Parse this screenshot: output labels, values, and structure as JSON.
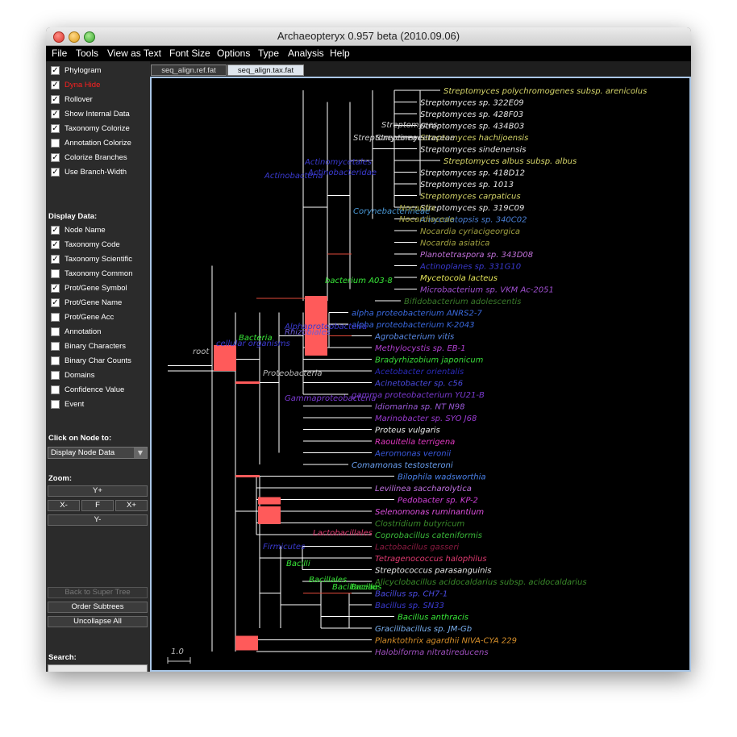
{
  "window": {
    "title": "Archaeopteryx 0.957 beta (2010.09.06)"
  },
  "menu": [
    "File",
    "Tools",
    "View as Text",
    "Font Size",
    "Options",
    "Type",
    "Analysis",
    "Help"
  ],
  "sidebar": {
    "options": [
      {
        "label": "Phylogram",
        "checked": true
      },
      {
        "label": "Dyna Hide",
        "checked": true,
        "color": "#ff2020"
      },
      {
        "label": "Rollover",
        "checked": true
      },
      {
        "label": "Show Internal Data",
        "checked": true
      },
      {
        "label": "Taxonomy Colorize",
        "checked": true
      },
      {
        "label": "Annotation Colorize",
        "checked": false
      },
      {
        "label": "Colorize Branches",
        "checked": true
      },
      {
        "label": "Use Branch-Width",
        "checked": true
      }
    ],
    "display_title": "Display Data:",
    "display": [
      {
        "label": "Node Name",
        "checked": true
      },
      {
        "label": "Taxonomy Code",
        "checked": true
      },
      {
        "label": "Taxonomy Scientific",
        "checked": true
      },
      {
        "label": "Taxonomy Common",
        "checked": false
      },
      {
        "label": "Prot/Gene Symbol",
        "checked": true
      },
      {
        "label": "Prot/Gene Name",
        "checked": true
      },
      {
        "label": "Prot/Gene Acc",
        "checked": false
      },
      {
        "label": "Annotation",
        "checked": false
      },
      {
        "label": "Binary Characters",
        "checked": false
      },
      {
        "label": "Binary Char Counts",
        "checked": false
      },
      {
        "label": "Domains",
        "checked": false
      },
      {
        "label": "Confidence Value",
        "checked": false
      },
      {
        "label": "Event",
        "checked": false
      }
    ],
    "click_title": "Click on Node to:",
    "click_value": "Display Node Data",
    "zoom_title": "Zoom:",
    "zoom": {
      "y_plus": "Y+",
      "x_minus": "X-",
      "fit": "F",
      "x_plus": "X+",
      "y_minus": "Y-"
    },
    "buttons": {
      "back": "Back to Super Tree",
      "order": "Order Subtrees",
      "uncollapse": "Uncollapse All"
    },
    "search_title": "Search:"
  },
  "tabs": [
    {
      "label": "seq_align.ref.fat",
      "active": false
    },
    {
      "label": "seq_align.tax.fat",
      "active": true
    }
  ],
  "tree": {
    "leaves": [
      {
        "label": "Streptomyces polychromogenes subsp. arenicolus",
        "color": "#d6d66a"
      },
      {
        "label": "Streptomyces sp. 322E09",
        "color": "#e8e8e8"
      },
      {
        "label": "Streptomyces sp. 428F03",
        "color": "#e8e8e8"
      },
      {
        "label": "Streptomyces sp. 434B03",
        "color": "#e8e8e8"
      },
      {
        "label": "Streptomyces hachijoensis",
        "color": "#d6d66a"
      },
      {
        "label": "Streptomyces sindenensis",
        "color": "#e8e8e8"
      },
      {
        "label": "Streptomyces albus subsp. albus",
        "color": "#d6d66a"
      },
      {
        "label": "Streptomyces sp. 418D12",
        "color": "#e8e8e8"
      },
      {
        "label": "Streptomyces sp. 1013",
        "color": "#e8e8e8"
      },
      {
        "label": "Streptomyces carpaticus",
        "color": "#d6d66a"
      },
      {
        "label": "Streptomyces sp. 319C09",
        "color": "#e8e8e8"
      },
      {
        "label": "Amycolatopsis sp. 340C02",
        "color": "#4a7fd4"
      },
      {
        "label": "Nocardia cyriacigeorgica",
        "color": "#a0a040"
      },
      {
        "label": "Nocardia asiatica",
        "color": "#a0a040"
      },
      {
        "label": "Planotetraspora sp. 343D08",
        "color": "#c070d8"
      },
      {
        "label": "Actinoplanes sp. 331G10",
        "color": "#3a3ad0"
      },
      {
        "label": "Mycetocola lacteus",
        "color": "#e8e85a"
      },
      {
        "label": "Microbacterium sp. VKM Ac-2051",
        "color": "#a050d0"
      },
      {
        "label": "Bifidobacterium adolescentis",
        "color": "#3a7a2a"
      },
      {
        "label": "alpha proteobacterium ANRS2-7",
        "color": "#3a6ae0"
      },
      {
        "label": "alpha proteobacterium K-2043",
        "color": "#3a6ae0"
      },
      {
        "label": "Agrobacterium vitis",
        "color": "#5a8ae8"
      },
      {
        "label": "Methylocystis sp. EB-1",
        "color": "#b040d0"
      },
      {
        "label": "Bradyrhizobium japonicum",
        "color": "#38d838"
      },
      {
        "label": "Acetobacter orientalis",
        "color": "#2a2ab8"
      },
      {
        "label": "Acinetobacter sp. c56",
        "color": "#4a4ae0"
      },
      {
        "label": "gamma proteobacterium YU21-B",
        "color": "#7a3ad0"
      },
      {
        "label": "Idiomarina sp. NT N98",
        "color": "#9a5ad8"
      },
      {
        "label": "Marinobacter sp. SYO J68",
        "color": "#9a3ad0"
      },
      {
        "label": "Proteus vulgaris",
        "color": "#e8e8e8"
      },
      {
        "label": "Raoultella terrigena",
        "color": "#e038c0"
      },
      {
        "label": "Aeromonas veronii",
        "color": "#3a5ae0"
      },
      {
        "label": "Comamonas testosteroni",
        "color": "#6aa0f0"
      },
      {
        "label": "Bilophila wadsworthia",
        "color": "#4a80e8"
      },
      {
        "label": "Levilinea saccharolytica",
        "color": "#c070e0"
      },
      {
        "label": "Pedobacter sp. KP-2",
        "color": "#d040d8"
      },
      {
        "label": "Selenomonas ruminantium",
        "color": "#e050e0"
      },
      {
        "label": "Clostridium butyricum",
        "color": "#3a8a2a"
      },
      {
        "label": "Coprobacillus cateniformis",
        "color": "#3ab83a"
      },
      {
        "label": "Lactobacillus gasseri",
        "color": "#8a1a40"
      },
      {
        "label": "Tetragenococcus halophilus",
        "color": "#e03a70"
      },
      {
        "label": "Streptococcus parasanguinis",
        "color": "#e8e8e8"
      },
      {
        "label": "Alicyclobacillus acidocaldarius subsp. acidocaldarius",
        "color": "#3a8a2a"
      },
      {
        "label": "Bacillus sp. CH7-1",
        "color": "#4a4ae0"
      },
      {
        "label": "Bacillus sp. SN33",
        "color": "#3a3ad0"
      },
      {
        "label": "Bacillus anthracis",
        "color": "#38e838"
      },
      {
        "label": "Gracilibacillus sp. JM-Gb",
        "color": "#7ab0f0"
      },
      {
        "label": "Planktothrix agardhii NIVA-CYA 229",
        "color": "#d8902a"
      },
      {
        "label": "Halobiforma nitratireducens",
        "color": "#a050c0"
      }
    ],
    "internal_labels": [
      {
        "label": "Streptomyces",
        "color": "#cfcfcf"
      },
      {
        "label": "Streptomycetaceae",
        "color": "#cfcfcf"
      },
      {
        "label": "Streptomycineae",
        "color": "#cfcfcf"
      },
      {
        "label": "Actinomycetales",
        "color": "#3a3ad0"
      },
      {
        "label": "Actinobacteridae",
        "color": "#3a3ad0"
      },
      {
        "label": "Actinobacteria",
        "color": "#3a3ad0"
      },
      {
        "label": "Corynebacterineae",
        "color": "#4a9ad8"
      },
      {
        "label": "Nocardia",
        "color": "#a0a040"
      },
      {
        "label": "Nocardiaceae",
        "color": "#a0a040"
      },
      {
        "label": "bacterium A03-8",
        "color": "#38e838"
      },
      {
        "label": "Alphaproteobacteria",
        "color": "#3a3ad0"
      },
      {
        "label": "Rhizobiales",
        "color": "#6a5ad8"
      },
      {
        "label": "Bacteria",
        "color": "#38e838"
      },
      {
        "label": "cellular organisms",
        "color": "#3a3ad0"
      },
      {
        "label": "root",
        "color": "#bbbbbb"
      },
      {
        "label": "Proteobacteria",
        "color": "#bbbbbb"
      },
      {
        "label": "Gammaproteobacteria",
        "color": "#7a3ad0"
      },
      {
        "label": "Firmicutes",
        "color": "#3a3ad0"
      },
      {
        "label": "Lactobacillales",
        "color": "#e03a70"
      },
      {
        "label": "Bacilli",
        "color": "#38e838"
      },
      {
        "label": "Bacillales",
        "color": "#38e838"
      },
      {
        "label": "Bacillaceae",
        "color": "#38e838"
      },
      {
        "label": "Bacillus",
        "color": "#38e838"
      }
    ],
    "scale_label": "1.0",
    "colors": {
      "branch": "#ffffff",
      "highlight": "#ff5a5a",
      "colored_branch": "#e04a3a"
    }
  }
}
